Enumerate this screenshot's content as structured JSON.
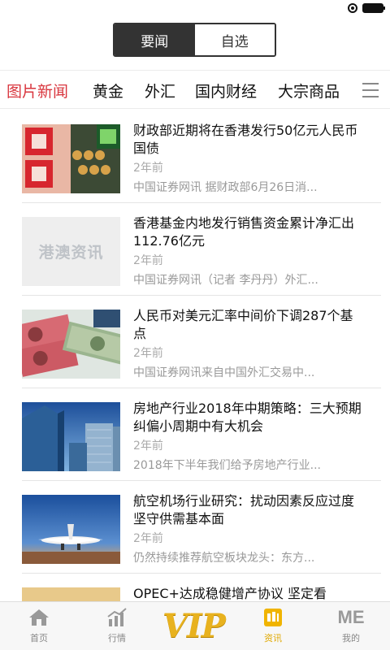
{
  "top_tabs": [
    {
      "label": "要闻",
      "active": true
    },
    {
      "label": "自选",
      "active": false
    }
  ],
  "categories": [
    {
      "label": "图片新闻",
      "active": true
    },
    {
      "label": "黄金",
      "active": false
    },
    {
      "label": "外汇",
      "active": false
    },
    {
      "label": "国内财经",
      "active": false
    },
    {
      "label": "大宗商品",
      "active": false
    }
  ],
  "articles": [
    {
      "title": "财政部近期将在香港发行50亿元人民币国债",
      "time": "2年前",
      "summary": "中国证券网讯 据财政部6月26日消..."
    },
    {
      "title": "香港基金内地发行销售资金累计净汇出112.76亿元",
      "time": "2年前",
      "summary": "中国证券网讯（记者 李丹丹）外汇...",
      "thumb_text": "港澳资讯"
    },
    {
      "title": "人民币对美元汇率中间价下调287个基点",
      "time": "2年前",
      "summary": "中国证券网讯来自中国外汇交易中..."
    },
    {
      "title": "房地产行业2018年中期策略：三大预期纠偏小周期中有大机会",
      "time": "2年前",
      "summary": "2018年下半年我们给予房地产行业..."
    },
    {
      "title": "航空机场行业研究：扰动因素反应过度 坚守供需基本面",
      "time": "2年前",
      "summary": "仍然持续推荐航空板块龙头：东方..."
    },
    {
      "title": "OPEC+达成稳健增产协议 坚定看",
      "time": "",
      "summary": ""
    }
  ],
  "bottom_tabs": [
    {
      "label": "首页",
      "icon": "home-icon"
    },
    {
      "label": "行情",
      "icon": "chart-icon"
    },
    {
      "label": "VIP",
      "icon": "vip-logo"
    },
    {
      "label": "资讯",
      "icon": "news-icon",
      "active": true
    },
    {
      "label": "我的",
      "icon": "me-icon",
      "icon_text": "ME"
    }
  ],
  "colors": {
    "accent_red": "#d9363e",
    "vip_gold": "#e8b21f",
    "active_tab": "#e0a800"
  }
}
